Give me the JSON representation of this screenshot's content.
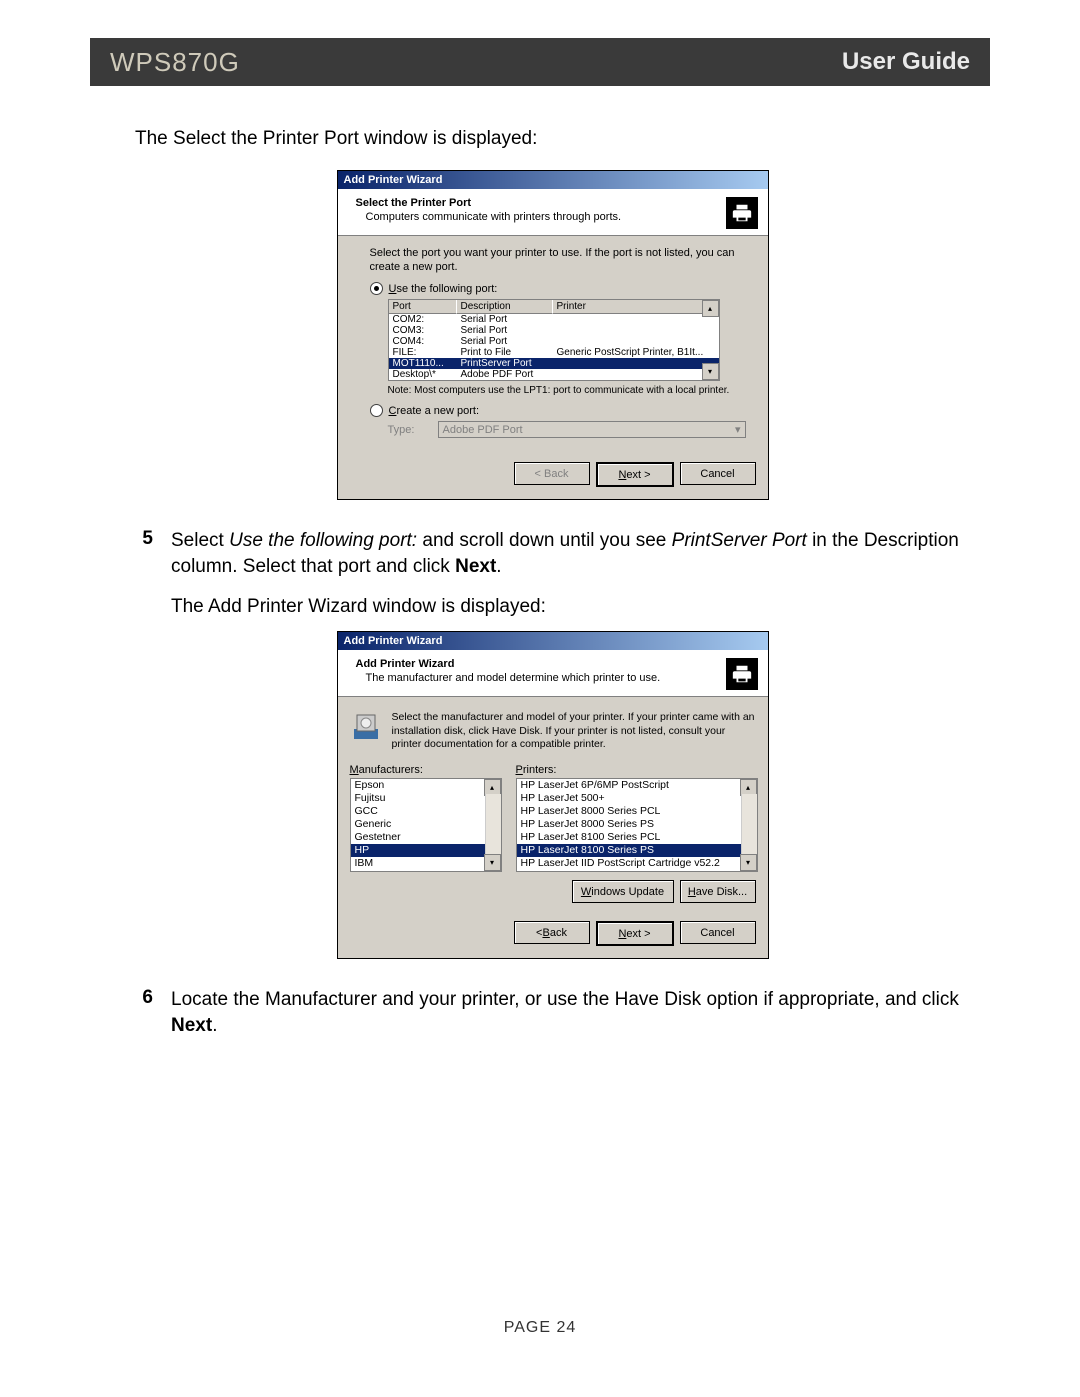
{
  "header": {
    "model": "WPS870G",
    "guide": "User Guide"
  },
  "intro1": "The Select the Printer Port window is displayed:",
  "wiz1": {
    "title": "Add Printer Wizard",
    "band_title": "Select the Printer Port",
    "band_sub": "Computers communicate with printers through ports.",
    "instr": "Select the port you want your printer to use. If the port is not listed, you can create a new port.",
    "radio_use": "Use the following port:",
    "cols": {
      "port": "Port",
      "desc": "Description",
      "printer": "Printer"
    },
    "rows": [
      {
        "port": "COM2:",
        "desc": "Serial Port",
        "printer": ""
      },
      {
        "port": "COM3:",
        "desc": "Serial Port",
        "printer": ""
      },
      {
        "port": "COM4:",
        "desc": "Serial Port",
        "printer": ""
      },
      {
        "port": "FILE:",
        "desc": "Print to File",
        "printer": "Generic PostScript Printer, B1It..."
      },
      {
        "port": "MOT1110...",
        "desc": "PrintServer Port",
        "printer": ""
      },
      {
        "port": "Desktop\\*",
        "desc": "Adobe PDF Port",
        "printer": ""
      }
    ],
    "selected_row": 4,
    "note": "Note: Most computers use the LPT1: port to communicate with a local printer.",
    "radio_create": "Create a new port:",
    "type_lbl": "Type:",
    "type_val": "Adobe PDF Port",
    "btn_back": "< Back",
    "btn_next": "Next >",
    "btn_cancel": "Cancel"
  },
  "step5": {
    "num": "5",
    "t1": "Select ",
    "i1": "Use the following port:",
    "t2": " and scroll down until you see ",
    "i2": "PrintServer Port",
    "t3": " in the Description column. Select that port and click ",
    "b1": "Next",
    "t4": ".",
    "after": "The Add Printer Wizard window is displayed:"
  },
  "wiz2": {
    "title": "Add Printer Wizard",
    "band_title": "Add Printer Wizard",
    "band_sub": "The manufacturer and model determine which printer to use.",
    "instr": "Select the manufacturer and model of your printer. If your printer came with an installation disk, click Have Disk. If your printer is not listed, consult your printer documentation for a compatible printer.",
    "mfr_lbl": "Manufacturers:",
    "prn_lbl": "Printers:",
    "manufacturers": [
      "Epson",
      "Fujitsu",
      "GCC",
      "Generic",
      "Gestetner",
      "HP",
      "IBM"
    ],
    "mfr_selected": 5,
    "printers": [
      "HP LaserJet 6P/6MP PostScript",
      "HP LaserJet 500+",
      "HP LaserJet 8000 Series PCL",
      "HP LaserJet 8000 Series PS",
      "HP LaserJet 8100 Series PCL",
      "HP LaserJet 8100 Series PS",
      "HP LaserJet IID PostScript Cartridge v52.2"
    ],
    "prn_selected": 5,
    "btn_winupd": "Windows Update",
    "btn_havedisk": "Have Disk...",
    "btn_back": "< Back",
    "btn_next": "Next >",
    "btn_cancel": "Cancel"
  },
  "step6": {
    "num": "6",
    "t1": "Locate the Manufacturer and your printer, or use the Have Disk option if appropriate, and click ",
    "b1": "Next",
    "t2": "."
  },
  "footer": "PAGE 24"
}
